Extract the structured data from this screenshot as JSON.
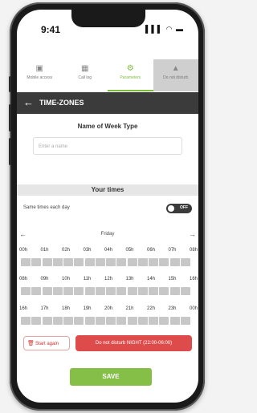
{
  "status": {
    "time": "9:41",
    "icons": "▌▌▌ ◠ ▬"
  },
  "tabs": [
    {
      "label": "Mobile access",
      "icon": "▣"
    },
    {
      "label": "Call log",
      "icon": "▦"
    },
    {
      "label": "Parameters",
      "icon": "⚙"
    },
    {
      "label": "Do not disturb",
      "icon": "▲"
    }
  ],
  "header": {
    "back_icon": "←",
    "title": "TIME-ZONES"
  },
  "week": {
    "label": "Name of Week Type",
    "placeholder": "Enter a name"
  },
  "times": {
    "heading": "Your times",
    "same_label": "Same times each day",
    "toggle": "OFF",
    "day": "Friday",
    "prev_icon": "←",
    "next_icon": "→",
    "hours_row1": [
      "00h",
      "01h",
      "02h",
      "03h",
      "04h",
      "05h",
      "06h",
      "07h",
      "08h"
    ],
    "hours_row2": [
      "08h",
      "09h",
      "10h",
      "11h",
      "12h",
      "13h",
      "14h",
      "15h",
      "16h"
    ],
    "hours_row3": [
      "16h",
      "17h",
      "18h",
      "19h",
      "20h",
      "21h",
      "22h",
      "23h",
      "00h"
    ]
  },
  "actions": {
    "start_again": "Start again",
    "trash_icon": "🗑",
    "night": "Do not disturb NIGHT (22:00-06:00)",
    "save": "SAVE"
  }
}
